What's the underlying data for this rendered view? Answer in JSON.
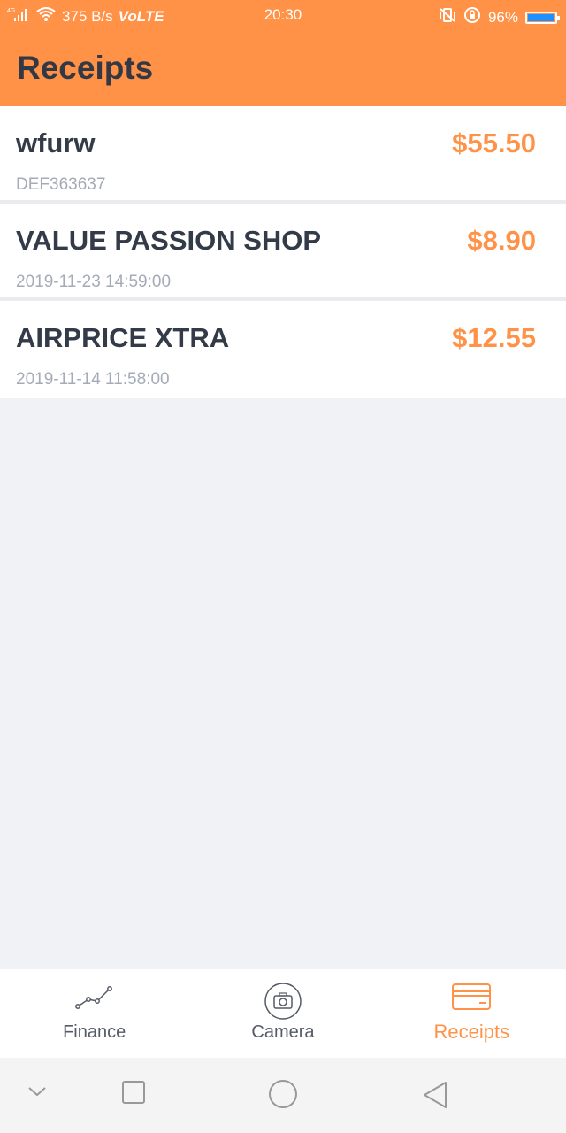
{
  "status_bar": {
    "network": "4G",
    "speed": "375 B/s",
    "volte": "VoLTE",
    "time": "20:30",
    "battery_text": "96%",
    "battery_level": 0.96,
    "battery_color": "#1e90ff"
  },
  "app_bar": {
    "title": "Receipts",
    "color": "#ff9247"
  },
  "receipts": [
    {
      "name": "wfurw",
      "sub": "DEF363637",
      "amount": "$55.50"
    },
    {
      "name": "VALUE PASSION SHOP",
      "sub": "2019-11-23 14:59:00",
      "amount": "$8.90"
    },
    {
      "name": "AIRPRICE XTRA",
      "sub": "2019-11-14 11:58:00",
      "amount": "$12.55"
    }
  ],
  "bottom_nav": {
    "items": [
      {
        "label": "Finance",
        "icon": "chart-line-icon",
        "active": false
      },
      {
        "label": "Camera",
        "icon": "camera-icon",
        "active": false
      },
      {
        "label": "Receipts",
        "icon": "receipt-card-icon",
        "active": true
      }
    ],
    "accent": "#ff9247"
  },
  "system_nav": {
    "items": [
      "chevron-down-icon",
      "recent-apps-icon",
      "home-icon",
      "back-icon"
    ]
  }
}
